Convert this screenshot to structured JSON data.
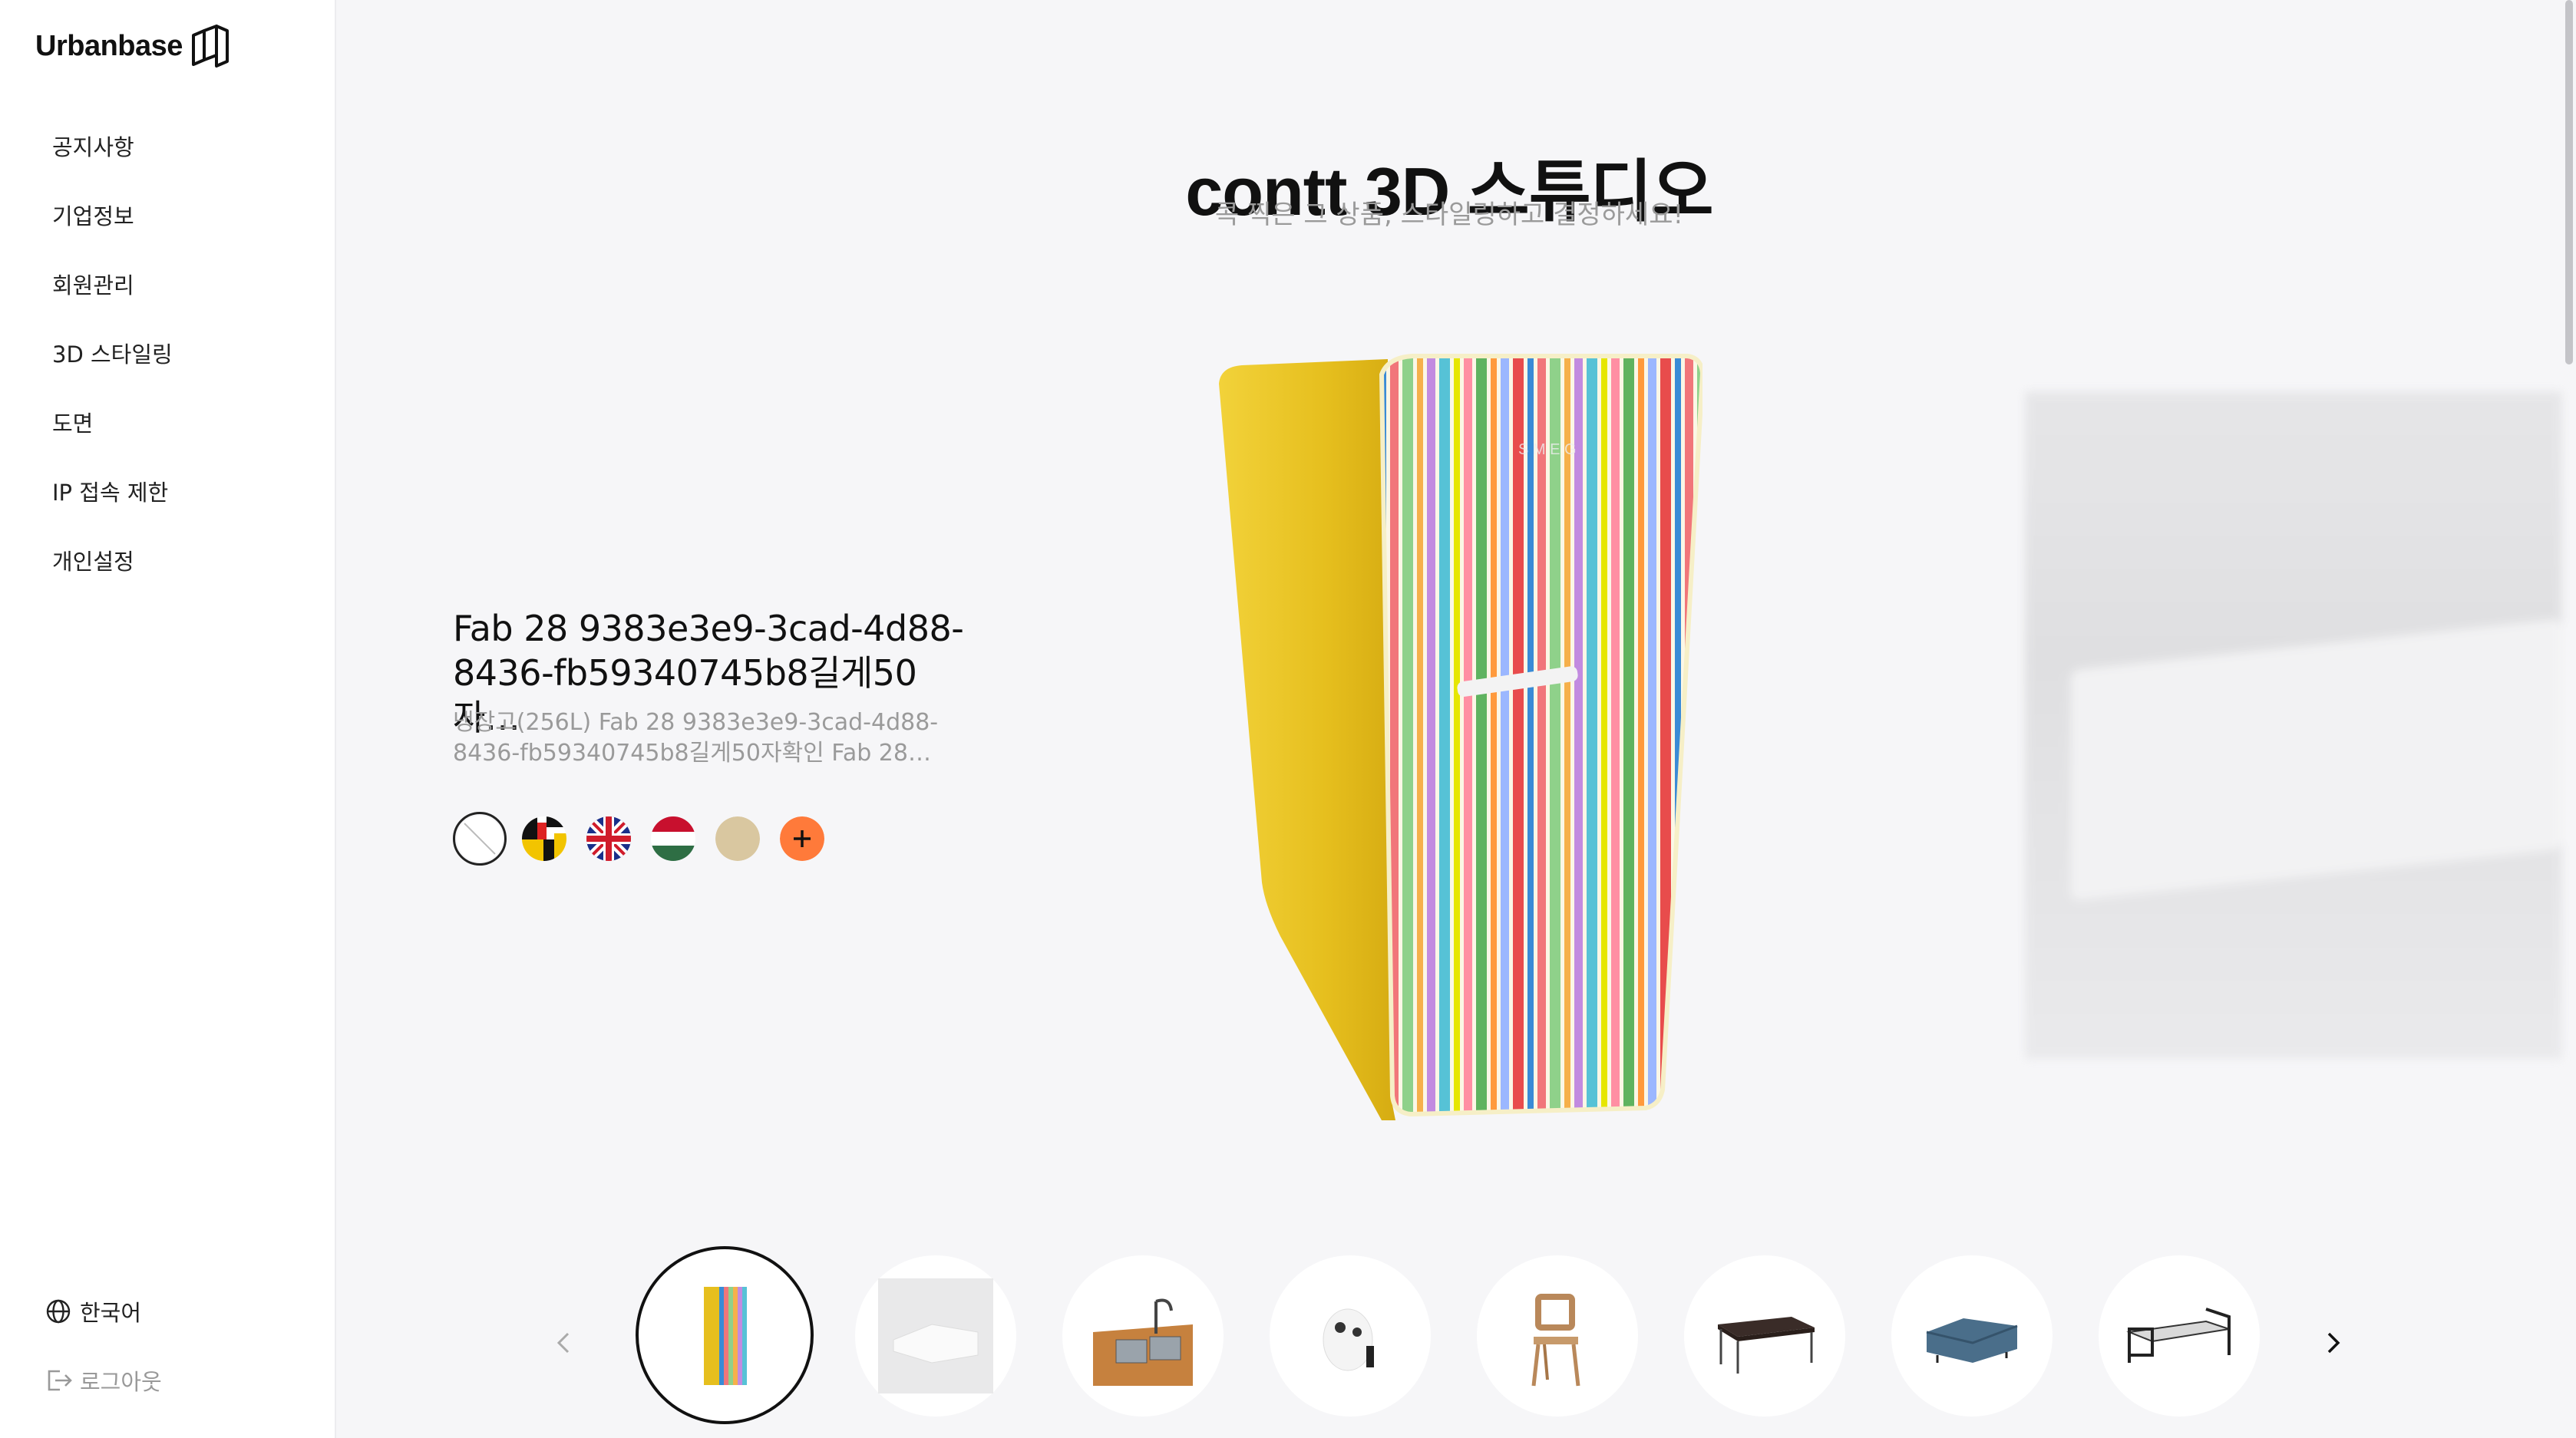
{
  "brand": {
    "name": "Urbanbase"
  },
  "sidebar": {
    "items": [
      {
        "label": "공지사항"
      },
      {
        "label": "기업정보"
      },
      {
        "label": "회원관리"
      },
      {
        "label": "3D 스타일링"
      },
      {
        "label": "도면"
      },
      {
        "label": "IP 접속 제한"
      },
      {
        "label": "개인설정"
      }
    ],
    "language": "한국어",
    "logout": "로그아웃"
  },
  "studio": {
    "title": "contt 3D 스튜디오",
    "subtitle": "콕 찍은 그 상품, 스타일링하고 결정하세요!"
  },
  "product": {
    "name": "Fab 28 9383e3e9-3cad-4d88-8436-fb59340745b8길게50자…",
    "description": "냉장고(256L) Fab 28 9383e3e9-3cad-4d88-8436-fb59340745b8길게50자확인 Fab 28…",
    "swatches": [
      {
        "icon": "no-color-icon",
        "selected": true
      },
      {
        "icon": "pattern-swatch-icon"
      },
      {
        "icon": "union-jack-swatch-icon"
      },
      {
        "icon": "hungary-flag-swatch-icon"
      },
      {
        "icon": "beige-swatch-icon",
        "color": "#d9c7a0"
      },
      {
        "icon": "add-color-icon",
        "color": "#ff7a3a"
      }
    ]
  },
  "carousel": {
    "items": [
      {
        "name": "fridge-thumbnail",
        "active": true
      },
      {
        "name": "white-sofa-thumbnail"
      },
      {
        "name": "kitchen-sink-thumbnail"
      },
      {
        "name": "air-fryer-thumbnail"
      },
      {
        "name": "wooden-chair-thumbnail"
      },
      {
        "name": "coffee-table-thumbnail"
      },
      {
        "name": "blue-sofa-thumbnail"
      },
      {
        "name": "metal-bed-thumbnail"
      }
    ]
  },
  "colors": {
    "fridge_body": "#e6bf1e",
    "accent_orange": "#ff7a3a",
    "muted_text": "#9a9a9a",
    "background": "#f6f6f8"
  }
}
